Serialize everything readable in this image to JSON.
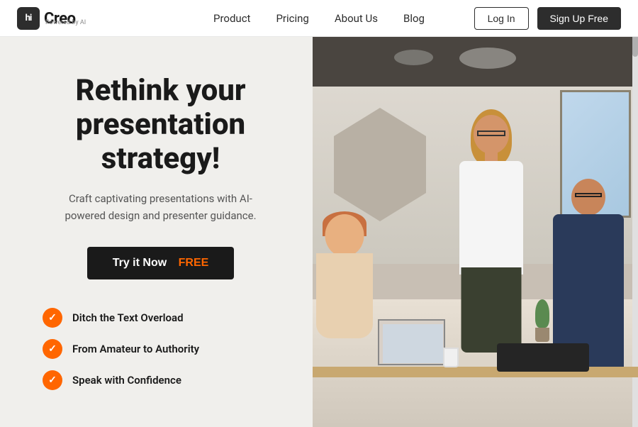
{
  "navbar": {
    "logo": {
      "badge": "hi",
      "name": "Creo",
      "sub": "Powered by AI"
    },
    "nav_items": [
      {
        "label": "Product",
        "href": "#"
      },
      {
        "label": "Pricing",
        "href": "#"
      },
      {
        "label": "About Us",
        "href": "#"
      },
      {
        "label": "Blog",
        "href": "#"
      }
    ],
    "login_label": "Log In",
    "signup_label": "Sign Up Free"
  },
  "hero": {
    "title": "Rethink your presentation strategy!",
    "subtitle": "Craft captivating presentations with AI-powered design and presenter guidance.",
    "cta_label": "Try it Now",
    "cta_free": "FREE",
    "features": [
      {
        "label": "Ditch the Text Overload"
      },
      {
        "label": "From Amateur to Authority"
      },
      {
        "label": "Speak with Confidence"
      }
    ]
  },
  "colors": {
    "accent": "#ff6600",
    "dark": "#1a1a1a",
    "bg": "#f0efec"
  }
}
